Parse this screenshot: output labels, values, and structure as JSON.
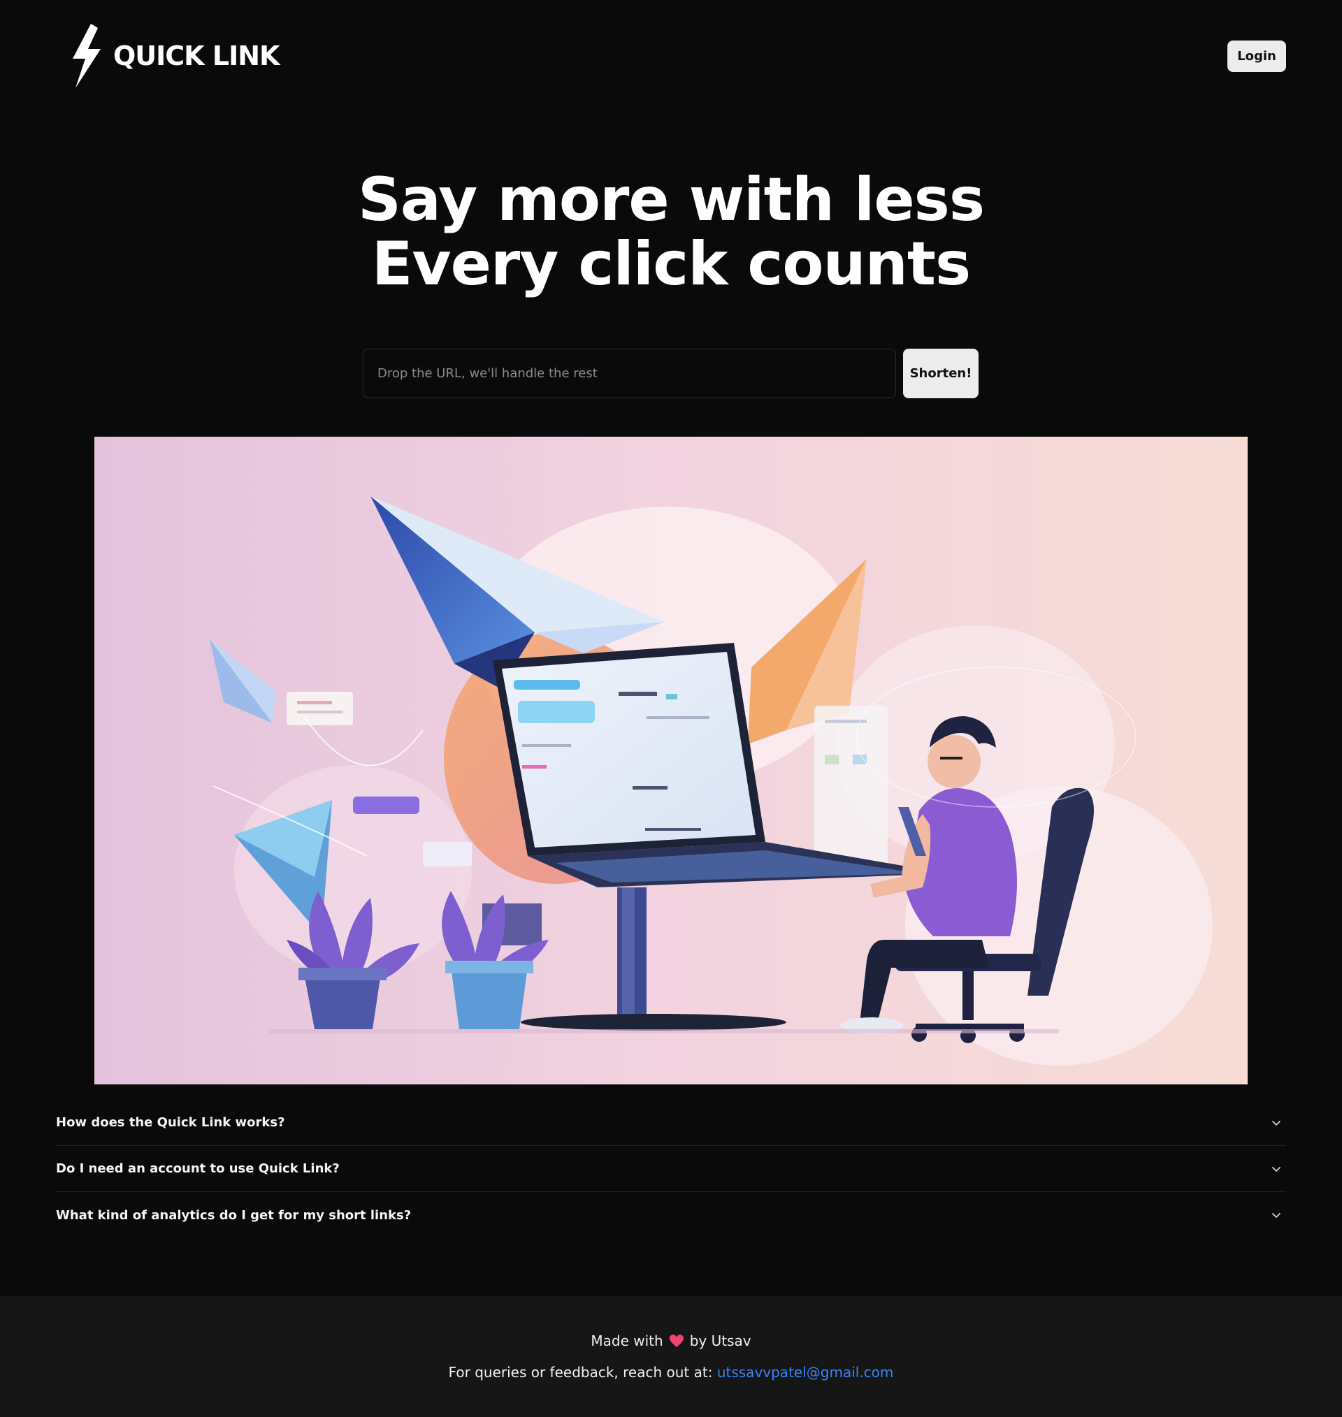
{
  "brand": {
    "name": "QUICK LINK",
    "icon": "lightning-bolt-icon"
  },
  "header": {
    "login_label": "Login"
  },
  "hero": {
    "title_line1": "Say more with less",
    "title_line2": "Every click counts",
    "input_placeholder": "Drop the URL, we'll handle the rest",
    "input_value": "",
    "shorten_label": "Shorten!"
  },
  "illustration": {
    "description_icon": "person-at-laptop-paper-planes-illustration"
  },
  "faq": {
    "items": [
      {
        "question": "How does the Quick Link works?"
      },
      {
        "question": "Do I need an account to use Quick Link?"
      },
      {
        "question": "What kind of analytics do I get for my short links?"
      }
    ]
  },
  "footer": {
    "made_with": "Made with",
    "by": "by Utsav",
    "feedback_text": "For queries or feedback, reach out at:",
    "email": "utssavvpatel@gmail.com"
  },
  "colors": {
    "background": "#0a0a0a",
    "footer_bg": "#161616",
    "button_bg": "#ececec",
    "link": "#3b82f6",
    "heart": "#ef4370"
  }
}
